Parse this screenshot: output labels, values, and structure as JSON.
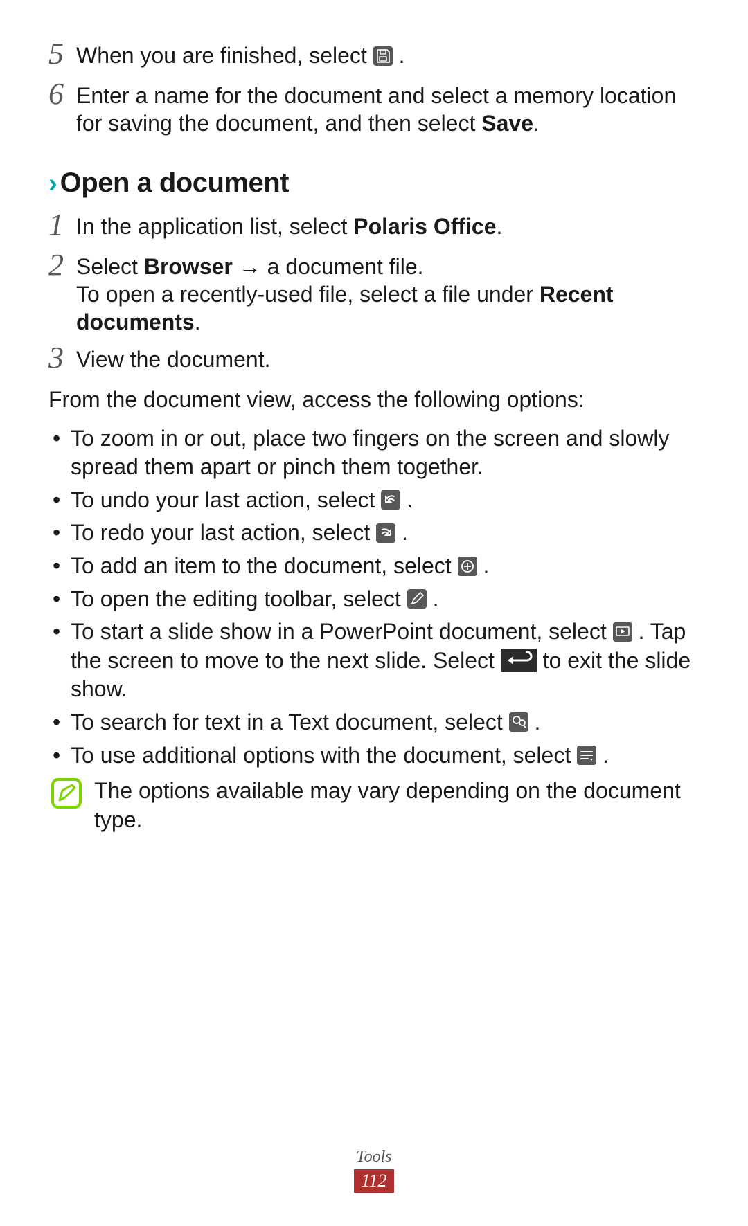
{
  "steps_top": [
    {
      "n": "5",
      "pre": "When you are finished, select ",
      "icon": "save",
      "post": "."
    },
    {
      "n": "6",
      "plain_pre": "Enter a name for the document and select a memory location for saving the document, and then select ",
      "bold": "Save",
      "plain_post": "."
    }
  ],
  "section": {
    "title": "Open a document"
  },
  "steps_open": [
    {
      "n": "1",
      "pre": "In the application list, select ",
      "b": "Polaris Office",
      "post": "."
    },
    {
      "n": "2",
      "pre": "Select ",
      "b": "Browser",
      "mid": " → a document file.",
      "line2a": "To open a recently-used file, select a file under ",
      "line2b": "Recent documents",
      "line2c": "."
    },
    {
      "n": "3",
      "t": "View the document."
    }
  ],
  "intro": "From the document view, access the following options:",
  "bullets": [
    {
      "t": "To zoom in or out, place two fingers on the screen and slowly spread them apart or pinch them together."
    },
    {
      "pre": "To undo your last action, select ",
      "icon": "undo",
      "post": "."
    },
    {
      "pre": "To redo your last action, select ",
      "icon": "redo",
      "post": "."
    },
    {
      "pre": "To add an item to the document, select ",
      "icon": "add",
      "post": "."
    },
    {
      "pre": "To open the editing toolbar, select ",
      "icon": "edit",
      "post": "."
    },
    {
      "pre": "To start a slide show in a PowerPoint document, select ",
      "icon": "play",
      "mid": ". Tap the screen to move to the next slide. Select ",
      "exit": true,
      "post": " to exit the slide show."
    },
    {
      "pre": "To search for text in a Text document, select ",
      "icon": "search",
      "post": "."
    },
    {
      "pre": "To use additional options with the document, select ",
      "icon": "menu",
      "post": "."
    }
  ],
  "note": "The options available may vary depending on the document type.",
  "footer": {
    "section": "Tools",
    "page": "112"
  }
}
